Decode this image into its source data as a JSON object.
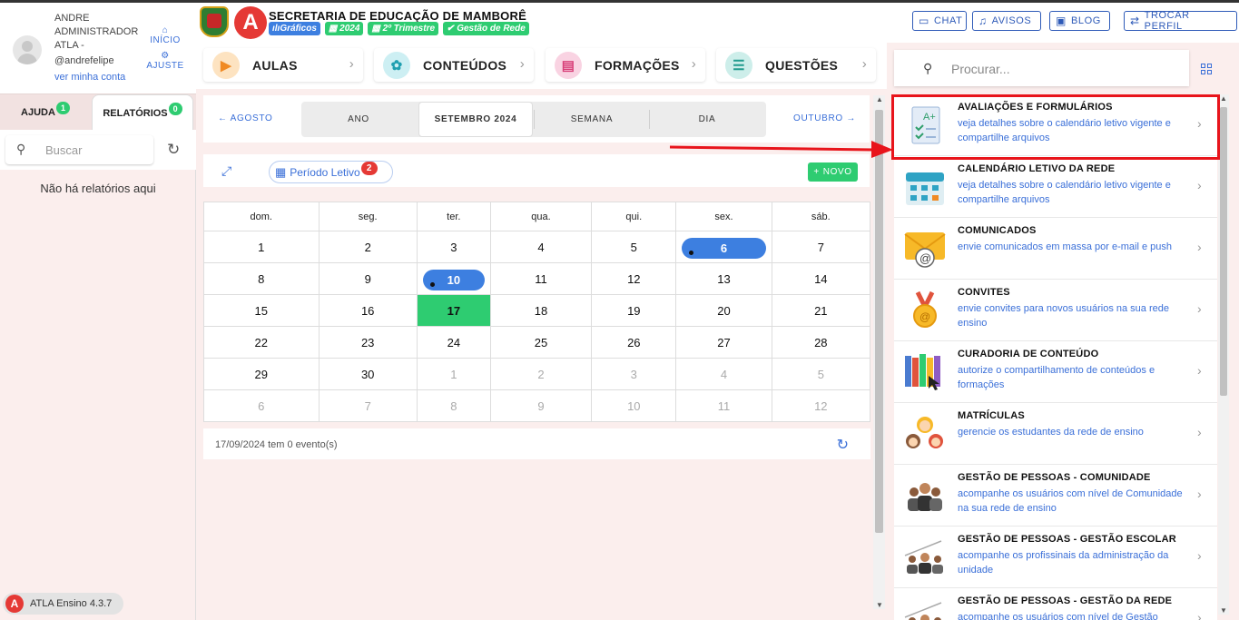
{
  "user": {
    "name": "ANDRE ADMINISTRADOR ATLA -",
    "handle": "@andrefelipe",
    "account_link": "ver minha conta"
  },
  "side_links": {
    "home": "INÍCIO",
    "settings": "AJUSTE"
  },
  "left_tabs": [
    {
      "label": "AJUDA",
      "badge": "1"
    },
    {
      "label": "RELATÓRIOS",
      "badge": "0"
    }
  ],
  "left_search": {
    "placeholder": "Buscar"
  },
  "left_empty": "Não há relatórios aqui",
  "version": "ATLA Ensino 4.3.7",
  "header": {
    "org": "SECRETARIA DE EDUCAÇÃO DE MAMBORÊ",
    "chips": [
      "Gráficos",
      "2024",
      "2º Trimestre",
      "Gestão de Rede"
    ],
    "buttons": {
      "chat": "CHAT",
      "avisos": "AVISOS",
      "blog": "BLOG",
      "trocar": "TROCAR PERFIL"
    }
  },
  "categories": [
    {
      "label": "AULAS",
      "icon": "aulas-icon",
      "color": "#f6a53a"
    },
    {
      "label": "CONTEÚDOS",
      "icon": "conteudos-icon",
      "color": "#29b6c8"
    },
    {
      "label": "FORMAÇÕES",
      "icon": "formacoes-icon",
      "color": "#e5508a"
    },
    {
      "label": "QUESTÕES",
      "icon": "questoes-icon",
      "color": "#33b3a6"
    }
  ],
  "calendar": {
    "prev": "AGOSTO",
    "next": "OUTUBRO",
    "views": [
      "ANO",
      "SETEMBRO 2024",
      "SEMANA",
      "DIA"
    ],
    "period_label": "Período Letivo",
    "period_badge": "2",
    "new_label": "NOVO",
    "weekdays": [
      "dom.",
      "seg.",
      "ter.",
      "qua.",
      "qui.",
      "sex.",
      "sáb."
    ],
    "weeks": [
      [
        "1",
        "2",
        "3",
        "4",
        "5",
        "6",
        "7"
      ],
      [
        "8",
        "9",
        "10",
        "11",
        "12",
        "13",
        "14"
      ],
      [
        "15",
        "16",
        "17",
        "18",
        "19",
        "20",
        "21"
      ],
      [
        "22",
        "23",
        "24",
        "25",
        "26",
        "27",
        "28"
      ],
      [
        "29",
        "30",
        "1",
        "2",
        "3",
        "4",
        "5"
      ],
      [
        "6",
        "7",
        "8",
        "9",
        "10",
        "11",
        "12"
      ]
    ],
    "status": "17/09/2024 tem 0 evento(s)"
  },
  "right_search": {
    "placeholder": "Procurar..."
  },
  "modules": [
    {
      "title": "AVALIAÇÕES E FORMULÁRIOS",
      "desc": "veja detalhes sobre o calendário letivo vigente e compartilhe arquivos"
    },
    {
      "title": "CALENDÁRIO LETIVO DA REDE",
      "desc": "veja detalhes sobre o calendário letivo vigente e compartilhe arquivos"
    },
    {
      "title": "COMUNICADOS",
      "desc": "envie comunicados em massa por e-mail e push"
    },
    {
      "title": "CONVITES",
      "desc": "envie convites para novos usuários na sua rede ensino"
    },
    {
      "title": "CURADORIA DE CONTEÚDO",
      "desc": "autorize o compartilhamento de conteúdos e formações"
    },
    {
      "title": "MATRÍCULAS",
      "desc": "gerencie os estudantes da rede de ensino"
    },
    {
      "title": "GESTÃO DE PESSOAS - COMUNIDADE",
      "desc": "acompanhe os usuários com nível de Comunidade na sua rede de ensino"
    },
    {
      "title": "GESTÃO DE PESSOAS - GESTÃO ESCOLAR",
      "desc": "acompanhe os profissinais da administração da unidade"
    },
    {
      "title": "GESTÃO DE PESSOAS - GESTÃO DA REDE",
      "desc": "acompanhe os usuários com nível de Gestão"
    }
  ]
}
